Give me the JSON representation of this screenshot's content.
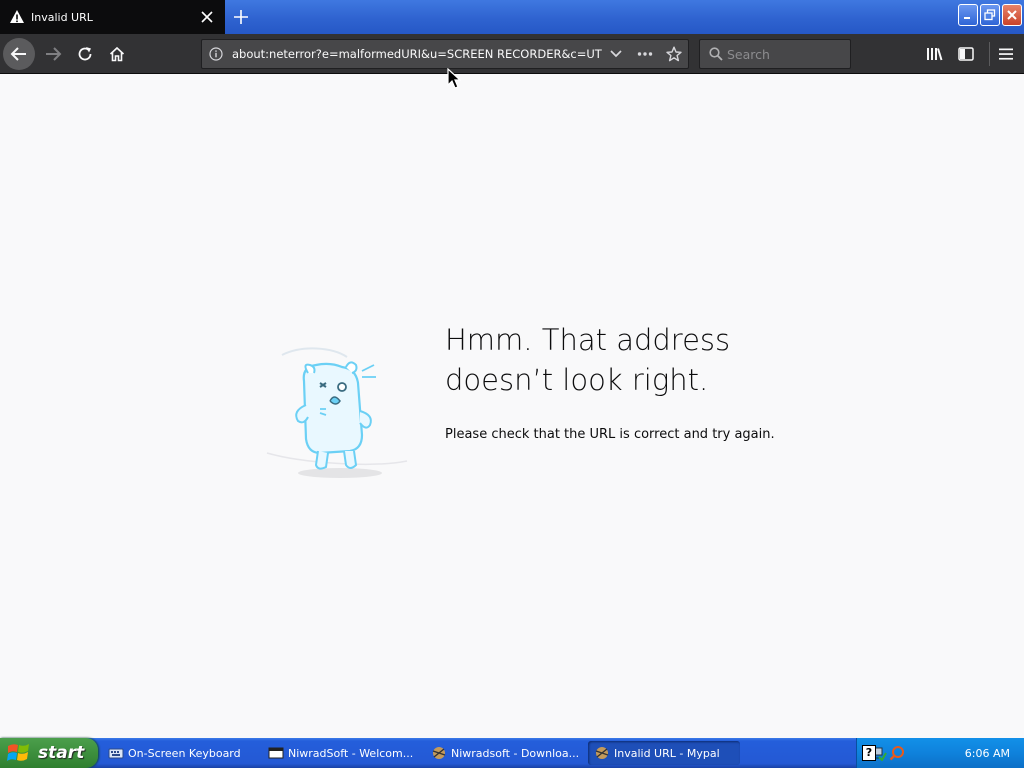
{
  "tab": {
    "title": "Invalid URL",
    "warning_icon": "warning-icon",
    "close_icon": "close-icon"
  },
  "newtab_icon": "plus-icon",
  "window_buttons": [
    "minimize-icon",
    "restore-icon",
    "close-icon"
  ],
  "toolbar": {
    "back_icon": "back-arrow-icon",
    "forward_icon": "forward-arrow-icon",
    "reload_icon": "reload-icon",
    "home_icon": "home-icon",
    "url": "about:neterror?e=malformedURI&u=SCREEN RECORDER&c=UTF",
    "search_placeholder": "Search",
    "library_icon": "library-icon",
    "sidebar_icon": "sidebar-icon",
    "menu_icon": "hamburger-menu-icon"
  },
  "error": {
    "title_line1": "Hmm. That address",
    "title_line2": "doesn’t look right.",
    "description": "Please check that the URL is correct and try again."
  },
  "taskbar": {
    "start_label": "start",
    "tasks": [
      {
        "label": "On-Screen Keyboard"
      },
      {
        "label": "NiwradSoft - Welcom..."
      },
      {
        "label": "Niwradsoft - Downloa..."
      },
      {
        "label": "Invalid URL - Mypal"
      }
    ],
    "clock": "6:06 AM"
  },
  "colors": {
    "tab_bg": "#0c0c0d",
    "toolbar_bg": "#323234",
    "urlbar_bg": "#474749",
    "page_bg": "#f9f9fa",
    "taskbar_blue": "#245edb",
    "start_green": "#3d8f3d",
    "tray_blue": "#0f82dc"
  }
}
